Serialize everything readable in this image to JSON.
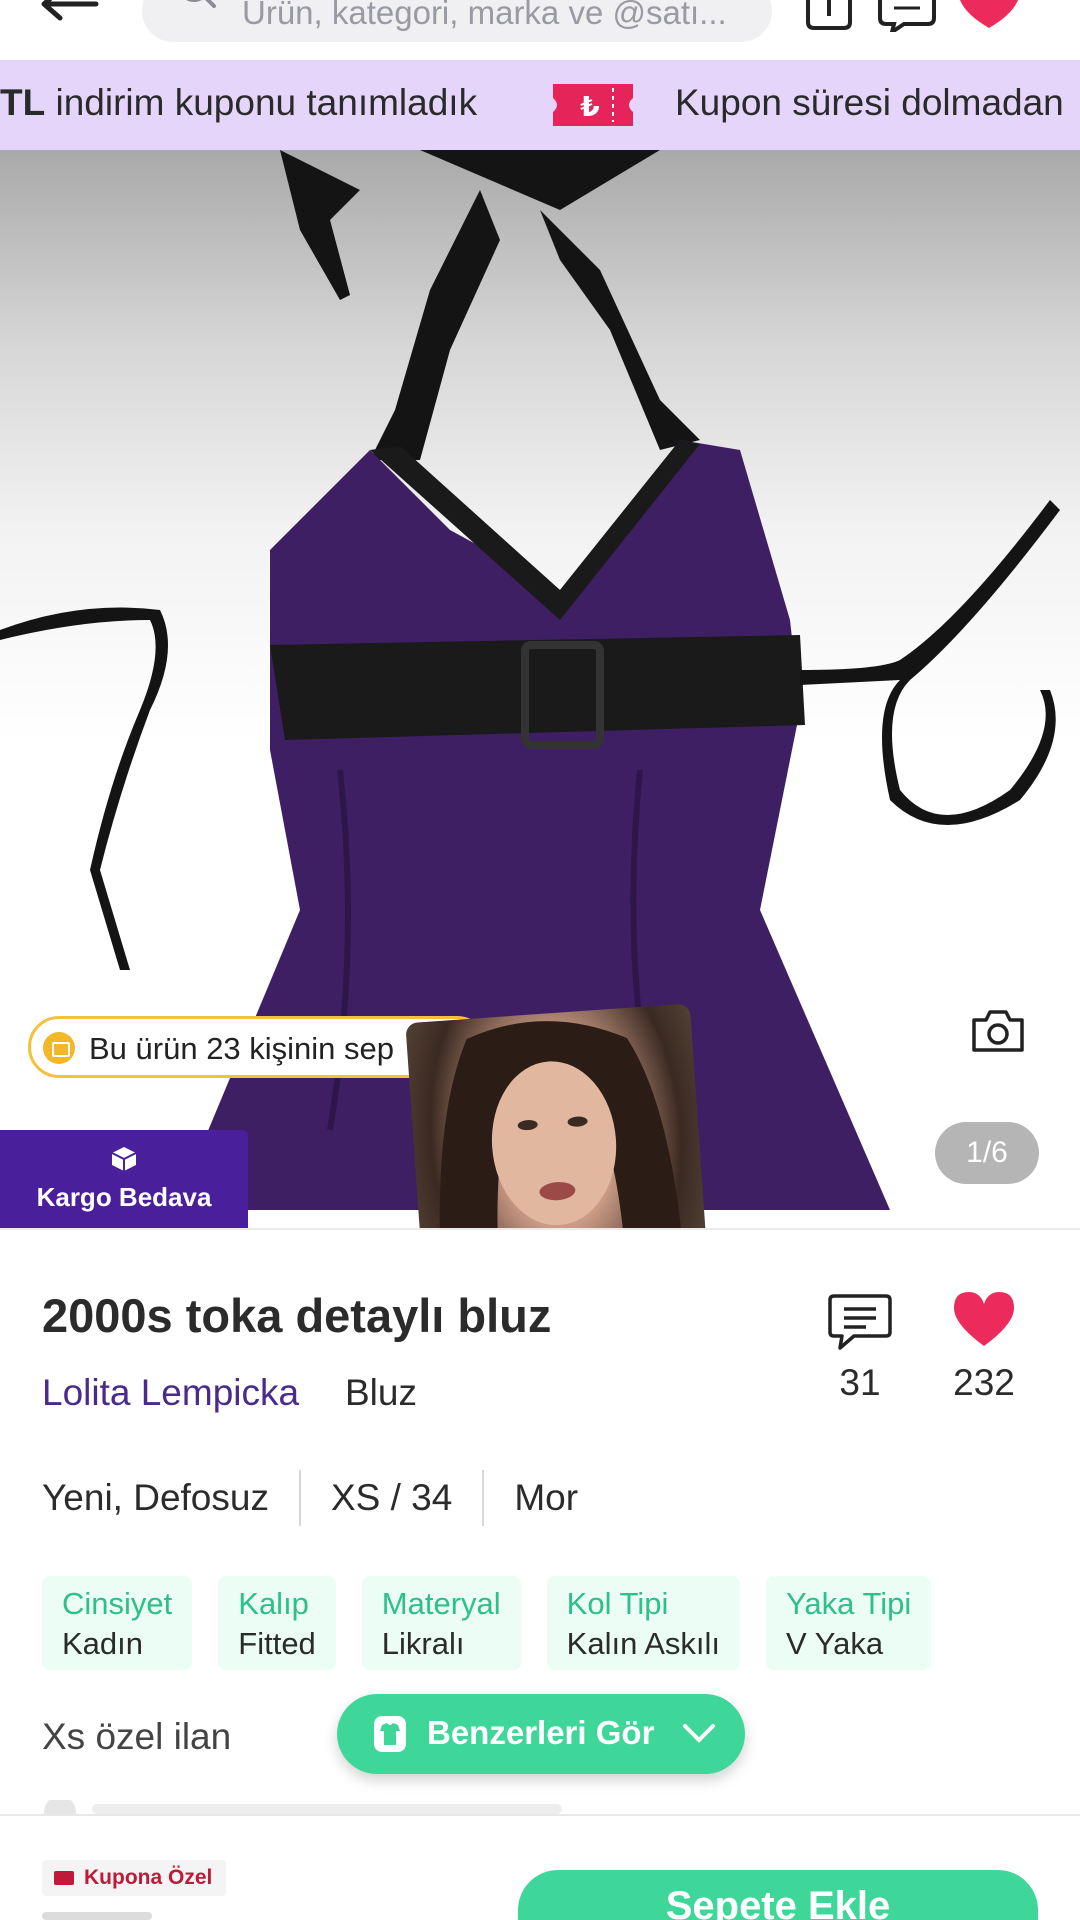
{
  "header": {
    "search_placeholder": "Ürün, kategori, marka ve @satı..."
  },
  "promo": {
    "text_bold": "TL",
    "text_rest": " indirim kuponu tanımladık",
    "text_2": "Kupon süresi dolmadan"
  },
  "hero": {
    "popular_text": "Bu ürün 23 kişinin sep",
    "page_indicator": "1/6",
    "shipping_label": "Kargo Bedava"
  },
  "product": {
    "title": "2000s toka detaylı bluz",
    "brand": "Lolita Lempicka",
    "category": "Bluz",
    "comment_count": "31",
    "like_count": "232",
    "condition": "Yeni, Defosuz",
    "size": "XS / 34",
    "color": "Mor",
    "attributes": [
      {
        "key": "Cinsiyet",
        "value": "Kadın"
      },
      {
        "key": "Kalıp",
        "value": "Fitted"
      },
      {
        "key": "Materyal",
        "value": "Likralı"
      },
      {
        "key": "Kol Tipi",
        "value": "Kalın Askılı"
      },
      {
        "key": "Yaka Tipi",
        "value": "V Yaka"
      }
    ],
    "description": "Xs özel ilan"
  },
  "actions": {
    "similar_label": "Benzerleri Gör",
    "coupon_badge": "Kupona Özel",
    "add_to_cart": "Sepete Ekle"
  },
  "colors": {
    "accent_green": "#3fd69a",
    "brand_purple": "#4a2a8c",
    "heart_pink": "#ec2a5c",
    "promo_bg": "#e6d5fb"
  }
}
